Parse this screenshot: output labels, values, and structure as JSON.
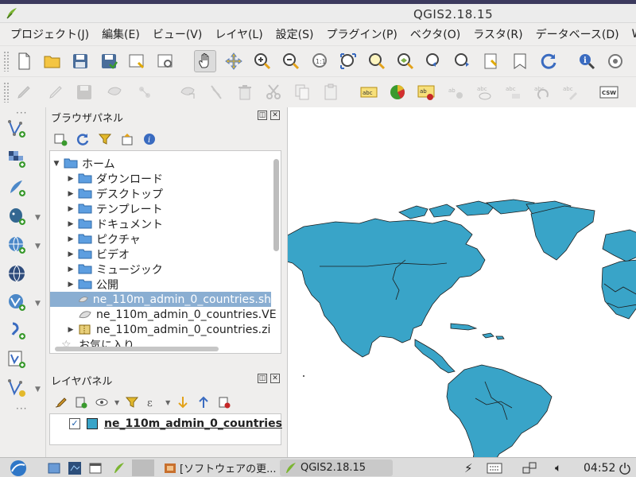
{
  "window": {
    "title": "QGIS2.18.15"
  },
  "menu": [
    "プロジェクト(J)",
    "編集(E)",
    "ビュー(V)",
    "レイヤ(L)",
    "設定(S)",
    "プラグイン(P)",
    "ベクタ(O)",
    "ラスタ(R)",
    "データベース(D)",
    "We"
  ],
  "browser_panel": {
    "title": "ブラウザパネル",
    "items": [
      {
        "label": "ホーム"
      },
      {
        "label": "ダウンロード"
      },
      {
        "label": "デスクトップ"
      },
      {
        "label": "テンプレート"
      },
      {
        "label": "ドキュメント"
      },
      {
        "label": "ピクチャ"
      },
      {
        "label": "ビデオ"
      },
      {
        "label": "ミュージック"
      },
      {
        "label": "公開"
      },
      {
        "label": "ne_110m_admin_0_countries.sh"
      },
      {
        "label": "ne_110m_admin_0_countries.VE"
      },
      {
        "label": "ne_110m_admin_0_countries.zi"
      },
      {
        "label": "お気に入り"
      }
    ]
  },
  "layers_panel": {
    "title": "レイヤパネル",
    "layers": [
      {
        "name": "ne_110m_admin_0_countries",
        "visible": true,
        "color": "#39a4c8"
      }
    ]
  },
  "taskbar": {
    "tasks": [
      {
        "label": "[ソフトウェアの更..."
      },
      {
        "label": "QGIS2.18.15"
      }
    ],
    "clock": "04:52"
  },
  "colors": {
    "country_fill": "#39a4c8",
    "selection": "#8aaed2"
  }
}
